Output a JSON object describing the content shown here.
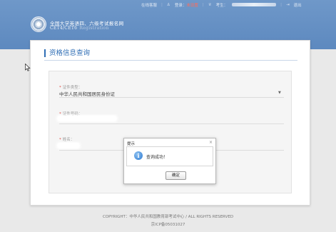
{
  "header": {
    "links": {
      "online_support": "在线客服",
      "login_prefix": "登录：",
      "login_status": "未设置",
      "candidate_prefix": "考生：",
      "logout": "退出"
    },
    "brand_cn": "全国大学英语四、六级考试报名网",
    "brand_en": "CET4/CET6",
    "brand_en_sub": "Registration"
  },
  "card": {
    "title": "资格信息查询",
    "fields": [
      {
        "label": "证件类型：",
        "value": "中华人民共和国居民身份证",
        "required": true
      },
      {
        "label": "证件号码：",
        "value": "",
        "required": true
      },
      {
        "label": "姓名：",
        "value": "",
        "required": true
      }
    ]
  },
  "dialog": {
    "title": "提示",
    "close": "×",
    "message": "查询成功！",
    "button": "确定"
  },
  "footer": {
    "line1": "COPYRIGHT：中华人民共和国教育部考试中心 / ALL RIGHTS RESERVED",
    "line2": "京ICP备05031027"
  },
  "colors": {
    "header_blue": "#6f98c9",
    "title_blue": "#2f6eb5",
    "required_red": "#e0453a",
    "login_status_red": "#ff6d5b"
  }
}
